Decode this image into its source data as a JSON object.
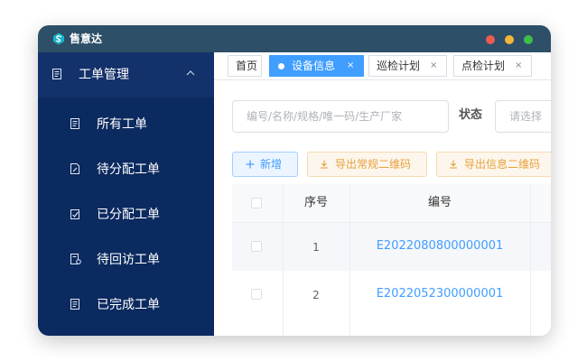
{
  "app": {
    "title": "售意达"
  },
  "colors": {
    "titlebar": "#2d4f68",
    "sidebar": "#0b2a5f",
    "accent": "#409eff",
    "warning": "#e6a23c"
  },
  "sidebar": {
    "group": {
      "label": "工单管理",
      "icon": "document-icon",
      "expanded": true
    },
    "items": [
      {
        "label": "所有工单",
        "icon": "document-icon"
      },
      {
        "label": "待分配工单",
        "icon": "edit-document-icon"
      },
      {
        "label": "已分配工单",
        "icon": "assigned-document-icon"
      },
      {
        "label": "待回访工单",
        "icon": "followup-document-icon"
      },
      {
        "label": "已完成工单",
        "icon": "document-icon"
      }
    ]
  },
  "tabs": [
    {
      "label": "首页",
      "active": false,
      "closable": false
    },
    {
      "label": "设备信息",
      "active": true,
      "closable": true,
      "close": "×"
    },
    {
      "label": "巡检计划",
      "active": false,
      "closable": true,
      "close": "×"
    },
    {
      "label": "点检计划",
      "active": false,
      "closable": true,
      "close": "×"
    }
  ],
  "search": {
    "placeholder": "编号/名称/规格/唯一码/生产厂家"
  },
  "status_filter": {
    "label": "状态",
    "placeholder": "请选择"
  },
  "toolbar": {
    "add_label": "新增",
    "export_regular_label": "导出常规二维码",
    "export_info_label": "导出信息二维码"
  },
  "table": {
    "columns": [
      "序号",
      "编号"
    ],
    "rows": [
      {
        "index": "1",
        "code": "E2022080800000001"
      },
      {
        "index": "2",
        "code": "E2022052300000001"
      }
    ]
  }
}
